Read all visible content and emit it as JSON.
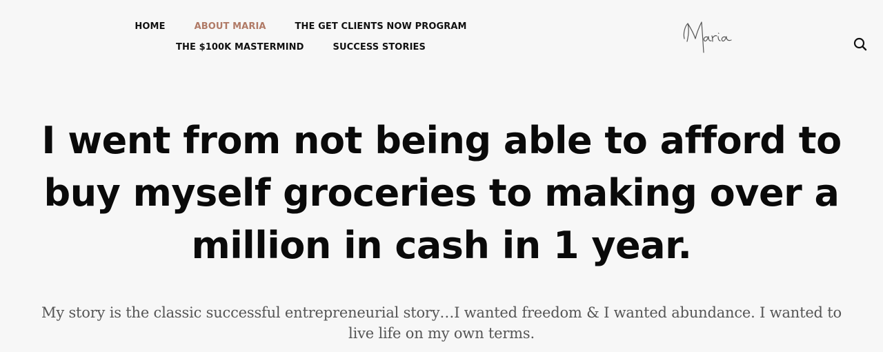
{
  "nav": {
    "items": [
      {
        "label": "HOME"
      },
      {
        "label": "ABOUT MARIA"
      },
      {
        "label": "THE GET CLIENTS NOW PROGRAM"
      },
      {
        "label": "THE $100K MASTERMIND"
      },
      {
        "label": "SUCCESS STORIES"
      }
    ],
    "active_color": "#b07a66"
  },
  "logo": {
    "text": "Maria"
  },
  "search": {
    "icon": "search-icon"
  },
  "hero": {
    "headline": "I went from not being able to afford to buy myself groceries to making over a million in cash in 1 year.",
    "intro": "My story is the classic successful entrepreneurial story…I wanted freedom & I wanted abundance. I wanted to live life on my own terms."
  }
}
